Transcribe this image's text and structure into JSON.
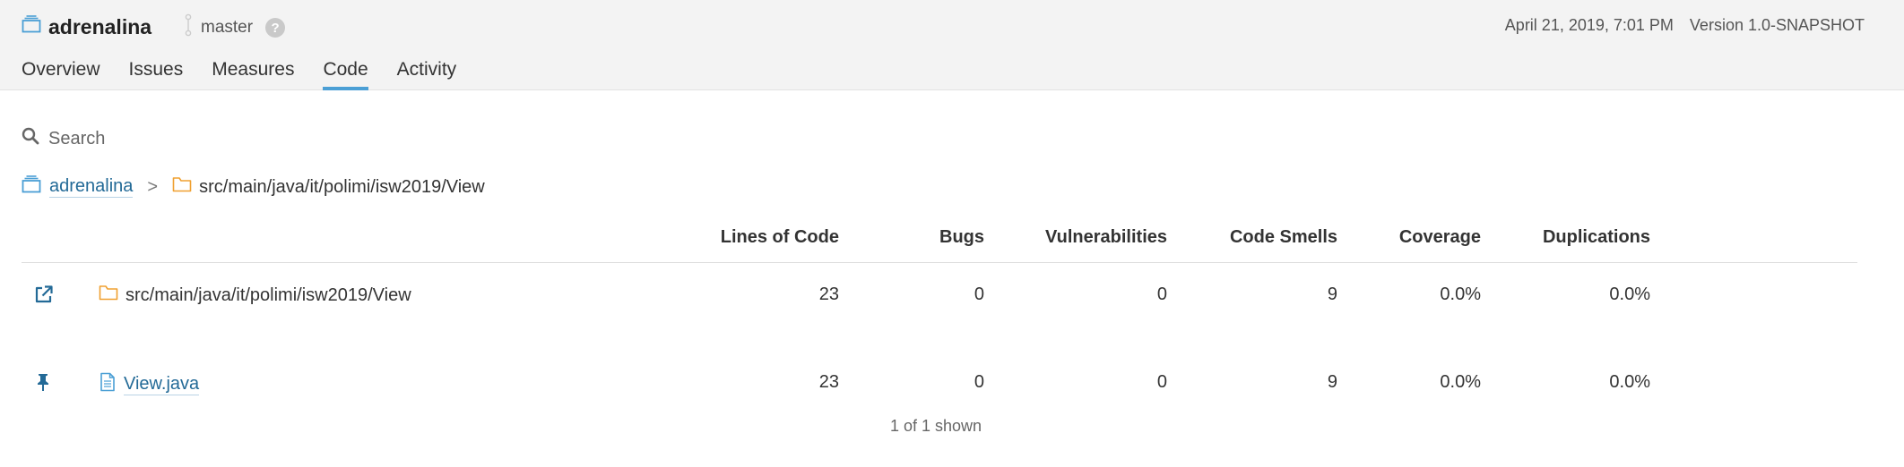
{
  "project": {
    "name": "adrenalina",
    "icon": "project-icon"
  },
  "branch": {
    "name": "master",
    "help": "?"
  },
  "meta": {
    "date": "April 21, 2019, 7:01 PM",
    "version": "Version 1.0-SNAPSHOT"
  },
  "tabs": [
    {
      "label": "Overview"
    },
    {
      "label": "Issues"
    },
    {
      "label": "Measures"
    },
    {
      "label": "Code",
      "active": true
    },
    {
      "label": "Activity"
    }
  ],
  "search": {
    "label": "Search"
  },
  "breadcrumb": {
    "root": "adrenalina",
    "separator": ">",
    "path": "src/main/java/it/polimi/isw2019/View"
  },
  "table": {
    "headers": [
      "Lines of Code",
      "Bugs",
      "Vulnerabilities",
      "Code Smells",
      "Coverage",
      "Duplications"
    ],
    "rows": [
      {
        "icon": "external-link-icon",
        "type": "folder",
        "name": "src/main/java/it/polimi/isw2019/View",
        "cells": [
          "23",
          "0",
          "0",
          "9",
          "0.0%",
          "0.0%"
        ]
      },
      {
        "icon": "pin-icon",
        "type": "file",
        "name": "View.java",
        "cells": [
          "23",
          "0",
          "0",
          "9",
          "0.0%",
          "0.0%"
        ]
      }
    ],
    "shown": "1 of 1 shown"
  },
  "colors": {
    "accent": "#4b9fd5",
    "link": "#236a97",
    "folder": "#f0a030"
  }
}
